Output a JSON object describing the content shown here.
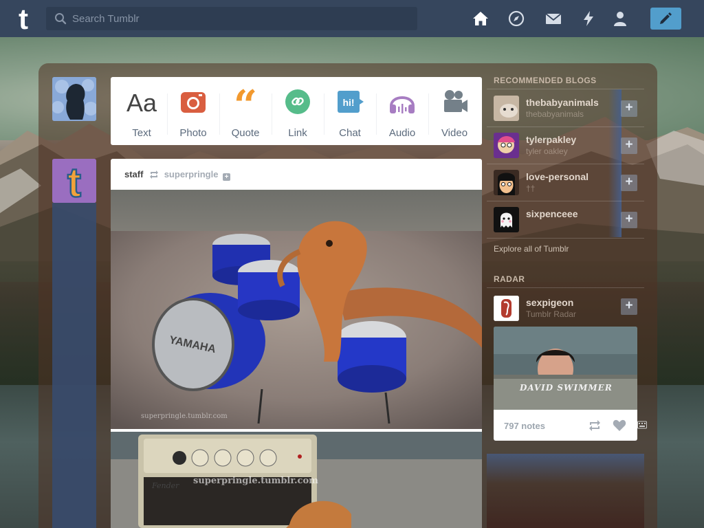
{
  "app": {
    "name": "Tumblr"
  },
  "search": {
    "placeholder": "Search Tumblr"
  },
  "nav": {
    "icons": [
      "home-icon",
      "compass-icon",
      "mail-icon",
      "lightning-icon",
      "person-icon"
    ],
    "compose_icon": "pencil-icon"
  },
  "colors": {
    "topbar": "#36465d",
    "search": "#2e3d52",
    "compose": "#529ecc",
    "photo": "#d95e40",
    "quote": "#f2992e",
    "link": "#56bc8a",
    "chat": "#529ecc",
    "audio": "#a77dc2",
    "video": "#748089"
  },
  "post_types": [
    {
      "label": "Text",
      "icon": "text-aa-icon"
    },
    {
      "label": "Photo",
      "icon": "camera-icon"
    },
    {
      "label": "Quote",
      "icon": "quote-icon"
    },
    {
      "label": "Link",
      "icon": "link-icon"
    },
    {
      "label": "Chat",
      "icon": "chat-bubble-icon"
    },
    {
      "label": "Audio",
      "icon": "headphones-icon"
    },
    {
      "label": "Video",
      "icon": "video-camera-icon"
    }
  ],
  "post": {
    "author": "staff",
    "reblogged_from": "superpringle",
    "watermark1": "superpringle.tumblr.com",
    "watermark2": "superpringle.tumblr.com",
    "amp_brand": "Fender"
  },
  "sidebar": {
    "recommended_title": "RECOMMENDED BLOGS",
    "blogs": [
      {
        "name": "thebabyanimals",
        "subtitle": "thebabyanimals"
      },
      {
        "name": "tylerpakley",
        "subtitle": "tyler oakley"
      },
      {
        "name": "love-personal",
        "subtitle": "††"
      },
      {
        "name": "sixpenceee",
        "subtitle": ""
      }
    ],
    "explore": "Explore all of Tumblr",
    "radar_title": "RADAR",
    "radar": {
      "name": "sexpigeon",
      "subtitle": "Tumblr Radar",
      "caption": "DAVID SWIMMER",
      "notes": "797 notes"
    }
  }
}
